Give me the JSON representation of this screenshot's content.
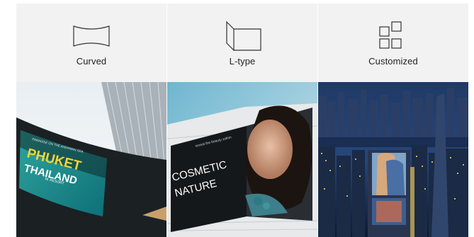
{
  "cards": [
    {
      "label": "Curved",
      "icon": "curved-display-icon",
      "photo_text": {
        "line1": "PHUKET",
        "line2": "THAILAND",
        "small": "W. RESORT",
        "tiny": "PARADISE ON THE ANDAMAN SEA"
      }
    },
    {
      "label": "L-type",
      "icon": "l-type-display-icon",
      "photo_text": {
        "line1": "COSMETIC",
        "line2": "NATURE",
        "tiny": "reveal the beauty within"
      }
    },
    {
      "label": "Customized",
      "icon": "customized-display-icon",
      "photo_text": {}
    }
  ],
  "colors": {
    "panel_bg": "#f2f2f2",
    "label": "#222222",
    "icon_stroke": "#333333"
  }
}
